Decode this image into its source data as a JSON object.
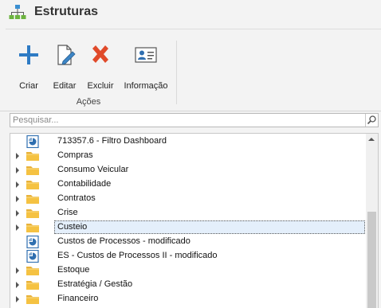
{
  "header": {
    "title": "Estruturas",
    "icon": "hierarchy-icon"
  },
  "ribbon": {
    "buttons": [
      {
        "label": "Criar",
        "icon": "plus-icon"
      },
      {
        "label": "Editar",
        "icon": "edit-document-icon"
      },
      {
        "label": "Excluir",
        "icon": "delete-x-icon"
      },
      {
        "label": "Informação",
        "icon": "contact-card-icon"
      }
    ],
    "group_label": "Ações"
  },
  "search": {
    "placeholder": "Pesquisar..."
  },
  "tree": {
    "selected_index": 6,
    "items": [
      {
        "label": "713357.6 - Filtro Dashboard",
        "type": "report"
      },
      {
        "label": "Compras",
        "type": "folder"
      },
      {
        "label": "Consumo Veicular",
        "type": "folder"
      },
      {
        "label": "Contabilidade",
        "type": "folder"
      },
      {
        "label": "Contratos",
        "type": "folder"
      },
      {
        "label": "Crise",
        "type": "folder"
      },
      {
        "label": "Custeio",
        "type": "folder"
      },
      {
        "label": "Custos de Processos - modificado",
        "type": "report"
      },
      {
        "label": "ES - Custos de Processos II - modificado",
        "type": "report"
      },
      {
        "label": "Estoque",
        "type": "folder"
      },
      {
        "label": "Estratégia / Gestão",
        "type": "folder"
      },
      {
        "label": "Financeiro",
        "type": "folder"
      }
    ]
  },
  "colors": {
    "folder": "#f5c242",
    "report": "#2f6fb0",
    "add": "#2e7bc4",
    "delete": "#e04a2a"
  }
}
